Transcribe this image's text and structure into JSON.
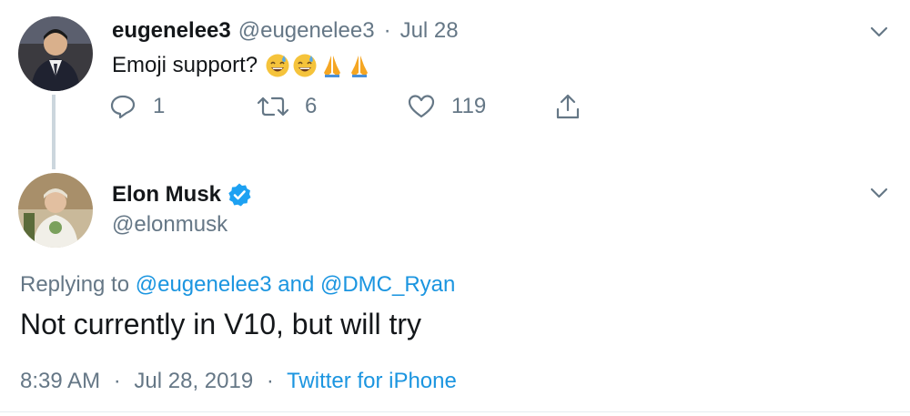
{
  "reply_tweet": {
    "display_name": "eugenelee3",
    "handle": "@eugenelee3",
    "separator": "·",
    "date": "Jul 28",
    "text": "Emoji support?",
    "emojis": [
      "😅",
      "😅",
      "🙏",
      "🙏"
    ],
    "reply_count": "1",
    "retweet_count": "6",
    "like_count": "119"
  },
  "main_tweet": {
    "display_name": "Elon Musk",
    "handle": "@elonmusk",
    "verified": true,
    "replying_prefix": "Replying to",
    "replying_user_1": "@eugenelee3",
    "replying_and": "and",
    "replying_user_2": "@DMC_Ryan",
    "text": "Not currently in V10, but will try",
    "time": "8:39 AM",
    "separator": "·",
    "date": "Jul 28, 2019",
    "source": "Twitter for iPhone"
  },
  "colors": {
    "link": "#1b95e0",
    "secondary_text": "#657786",
    "primary_text": "#14171a",
    "thread_line": "#ccd6dd",
    "verified_badge": "#1da1f2",
    "emoji_face": "#f5c33b",
    "emoji_hands": "#f5a623"
  },
  "icons": {
    "reply": "reply-icon",
    "retweet": "retweet-icon",
    "like": "heart-icon",
    "share": "share-icon",
    "more": "chevron-down-icon",
    "verified": "verified-badge-icon"
  }
}
